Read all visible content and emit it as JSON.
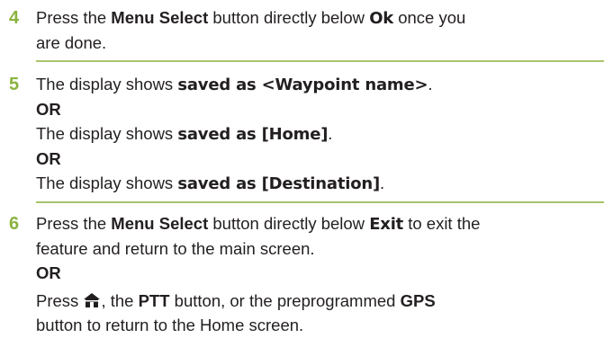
{
  "steps": [
    {
      "number": "4",
      "t1": "Press the ",
      "b1": "Menu Select",
      "t2": " button directly below ",
      "d1": "Ok",
      "t3": " once you",
      "t4": "are done."
    },
    {
      "number": "5",
      "prefix": "The display shows ",
      "msg1": "saved as <Waypoint name>",
      "msg2": "saved as [Home]",
      "msg3": "saved as [Destination]",
      "period": ".",
      "or": "OR"
    },
    {
      "number": "6",
      "t1": "Press the ",
      "b1": "Menu Select",
      "t2": " button directly below ",
      "d1": "Exit",
      "t3": " to exit the",
      "t4": "feature and return to the main screen.",
      "or": "OR",
      "t5": "Press ",
      "t6": ", the ",
      "b2": "PTT",
      "t7": " button, or the preprogrammed ",
      "b3": "GPS",
      "t8": "button to return to the Home screen.",
      "icon": "home-icon"
    }
  ],
  "colors": {
    "step_number": "#8ab33f",
    "rule": "#a9c36a",
    "text": "#231f20"
  }
}
